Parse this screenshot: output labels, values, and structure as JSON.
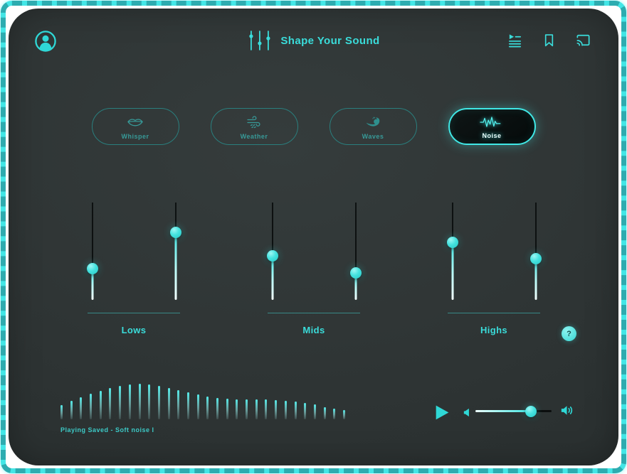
{
  "app": {
    "title": "Shape Your Sound"
  },
  "header": {
    "left_icon": "user-avatar-icon",
    "title_icon": "equalizer-sliders-icon",
    "right_icons": [
      "playlist-play-icon",
      "bookmark-icon",
      "cast-icon"
    ]
  },
  "categories": [
    {
      "label": "Whisper",
      "icon": "lips-icon",
      "selected": false
    },
    {
      "label": "Weather",
      "icon": "wind-icon",
      "selected": false
    },
    {
      "label": "Waves",
      "icon": "wave-icon",
      "selected": false
    },
    {
      "label": "Noise",
      "icon": "noise-waveform-icon",
      "selected": true
    }
  ],
  "equalizer": {
    "groups": [
      {
        "label": "Lows",
        "sliders": [
          {
            "value_pct": 32
          },
          {
            "value_pct": 69
          }
        ]
      },
      {
        "label": "Mids",
        "sliders": [
          {
            "value_pct": 45
          },
          {
            "value_pct": 28
          }
        ]
      },
      {
        "label": "Highs",
        "sliders": [
          {
            "value_pct": 59
          },
          {
            "value_pct": 42
          }
        ]
      }
    ],
    "help_label": "?"
  },
  "player": {
    "status_text": "Playing Saved  -  Soft noise I",
    "waveform_heights": [
      20,
      26,
      31,
      36,
      40,
      44,
      47,
      49,
      50,
      49,
      47,
      44,
      41,
      38,
      35,
      32,
      30,
      29,
      28,
      28,
      28,
      28,
      27,
      26,
      25,
      23,
      21,
      17,
      15,
      13
    ],
    "volume_pct": 73,
    "icons": [
      "play-icon",
      "volume-down-icon",
      "volume-up-icon"
    ]
  },
  "colors": {
    "accent": "#3FE3E1",
    "teal_muted": "#379A98",
    "window_bg": "#2E3434",
    "selected_bg": "#0A1010",
    "border": "#43E6E6"
  }
}
